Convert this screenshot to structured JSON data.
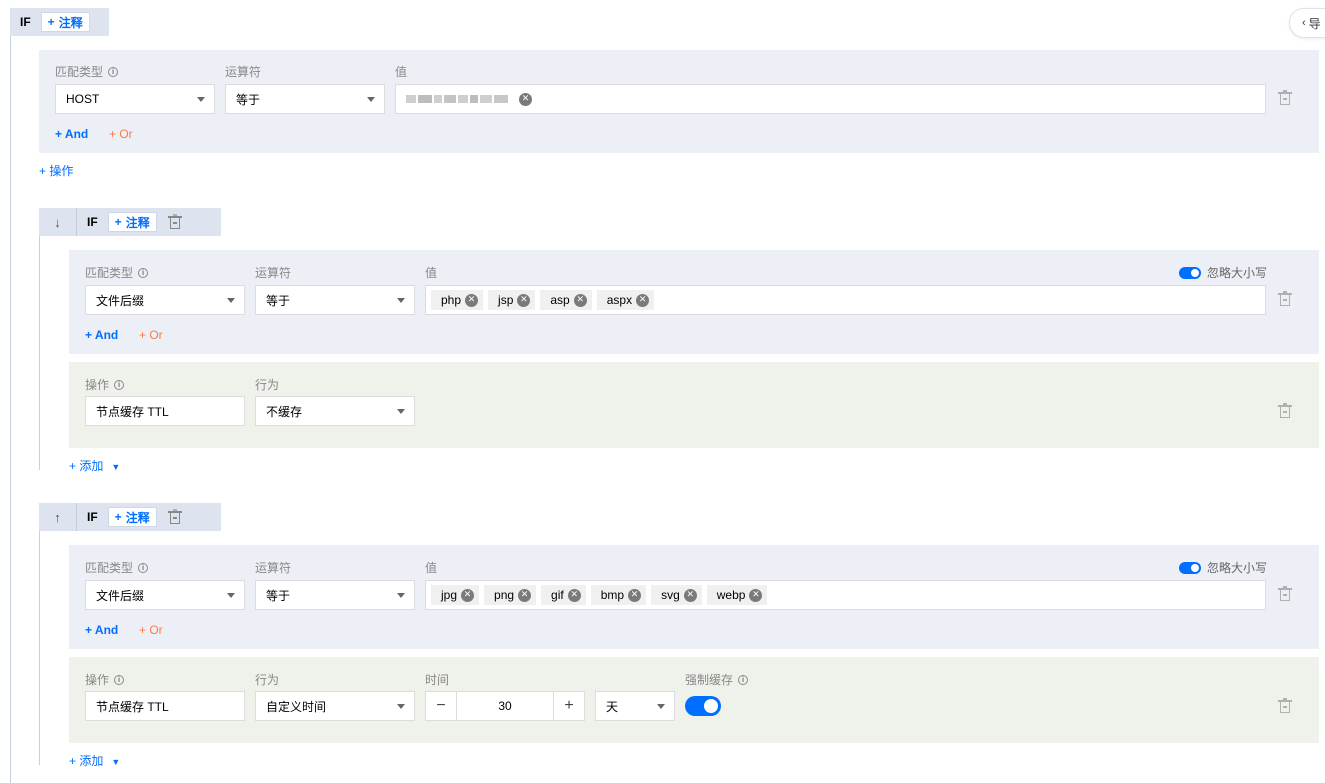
{
  "side_tab": {
    "icon": "chevron-left-icon",
    "label": "导"
  },
  "rule1": {
    "if_label": "IF",
    "note_label": "注释",
    "cond": {
      "match_type_label": "匹配类型",
      "operator_label": "运算符",
      "value_label": "值",
      "match_type_value": "HOST",
      "operator_value": "等于",
      "and_label": "And",
      "or_label": "Or"
    },
    "add_action_label": "操作"
  },
  "rule2": {
    "if_label": "IF",
    "note_label": "注释",
    "cond": {
      "match_type_label": "匹配类型",
      "operator_label": "运算符",
      "value_label": "值",
      "ignore_case_label": "忽略大小写",
      "match_type_value": "文件后缀",
      "operator_value": "等于",
      "tags": [
        "php",
        "jsp",
        "asp",
        "aspx"
      ],
      "and_label": "And",
      "or_label": "Or"
    },
    "action": {
      "op_label": "操作",
      "behavior_label": "行为",
      "op_value": "节点缓存 TTL",
      "behavior_value": "不缓存"
    },
    "add_label": "添加"
  },
  "rule3": {
    "if_label": "IF",
    "note_label": "注释",
    "cond": {
      "match_type_label": "匹配类型",
      "operator_label": "运算符",
      "value_label": "值",
      "ignore_case_label": "忽略大小写",
      "match_type_value": "文件后缀",
      "operator_value": "等于",
      "tags": [
        "jpg",
        "png",
        "gif",
        "bmp",
        "svg",
        "webp"
      ],
      "and_label": "And",
      "or_label": "Or"
    },
    "action": {
      "op_label": "操作",
      "behavior_label": "行为",
      "time_label": "时间",
      "force_label": "强制缓存",
      "op_value": "节点缓存 TTL",
      "behavior_value": "自定义时间",
      "time_value": "30",
      "unit_value": "天"
    },
    "add_label": "添加"
  }
}
